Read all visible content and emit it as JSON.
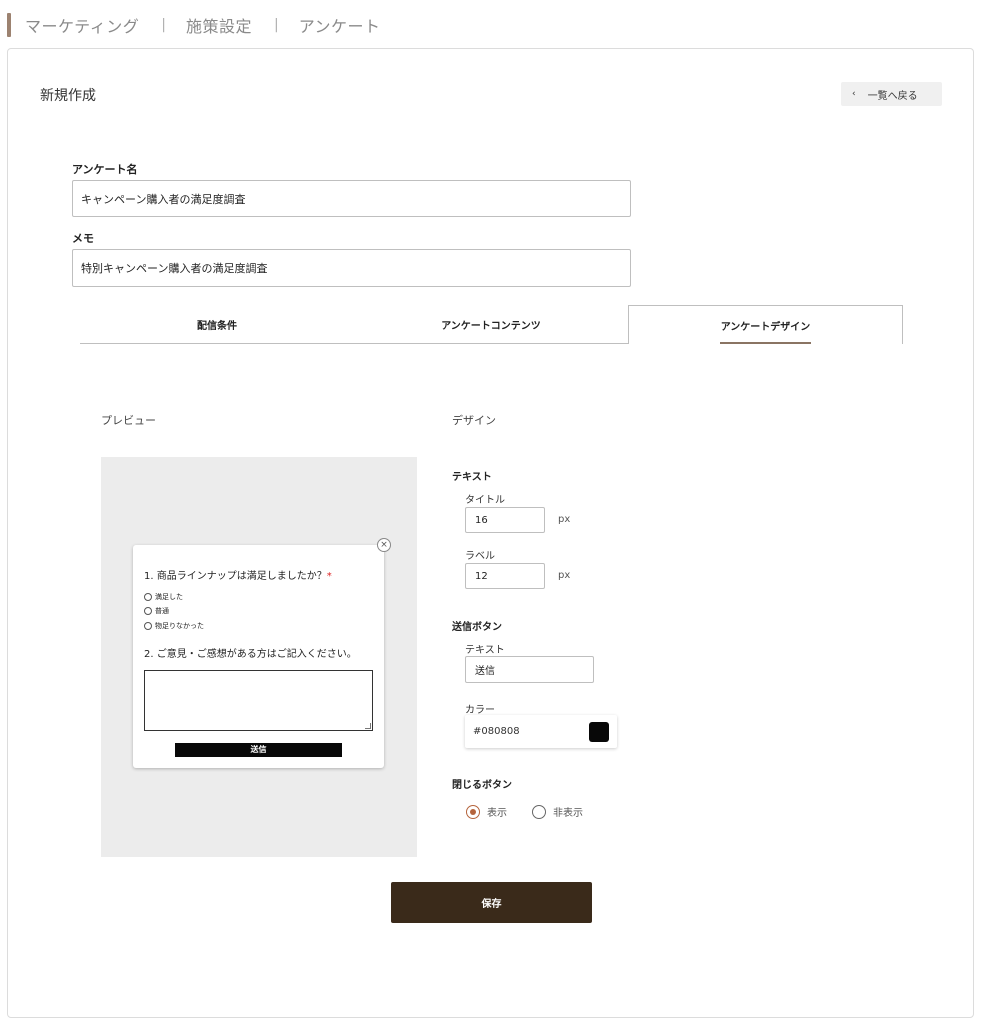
{
  "breadcrumb": {
    "items": [
      "マーケティング",
      "施策設定",
      "アンケート"
    ],
    "separator": "|"
  },
  "header": {
    "title": "新規作成",
    "back_label": "一覧へ戻る",
    "back_icon": "chevron-left-icon"
  },
  "form": {
    "survey_name_label": "アンケート名",
    "survey_name_value": "キャンペーン購入者の満足度調査",
    "memo_label": "メモ",
    "memo_value": "特別キャンペーン購入者の満足度調査"
  },
  "tabs": [
    {
      "label": "配信条件",
      "active": false
    },
    {
      "label": "アンケートコンテンツ",
      "active": false
    },
    {
      "label": "アンケートデザイン",
      "active": true
    }
  ],
  "preview": {
    "section_label": "プレビュー",
    "close_icon": "close-icon",
    "question1": "1. 商品ラインナップは満足しましたか？",
    "required_mark": "*",
    "options": [
      "満足した",
      "普通",
      "物足りなかった"
    ],
    "question2": "2. ご意見・ご感想がある方はご記入ください。",
    "submit_label": "送信"
  },
  "design": {
    "section_label": "デザイン",
    "text_group_label": "テキスト",
    "title_size_label": "タイトル",
    "title_size_value": "16",
    "label_size_label": "ラベル",
    "label_size_value": "12",
    "unit": "px",
    "submit_group_label": "送信ボタン",
    "submit_text_label": "テキスト",
    "submit_text_value": "送信",
    "color_label": "カラー",
    "color_value": "#080808",
    "close_group_label": "閉じるボタン",
    "close_options": [
      {
        "label": "表示",
        "checked": true
      },
      {
        "label": "非表示",
        "checked": false
      }
    ]
  },
  "footer": {
    "save_label": "保存"
  },
  "colors": {
    "accent": "#b5643c",
    "save_button": "#3a2a1a",
    "preview_submit": "#080808",
    "breadcrumb_bar": "#9c8270"
  }
}
